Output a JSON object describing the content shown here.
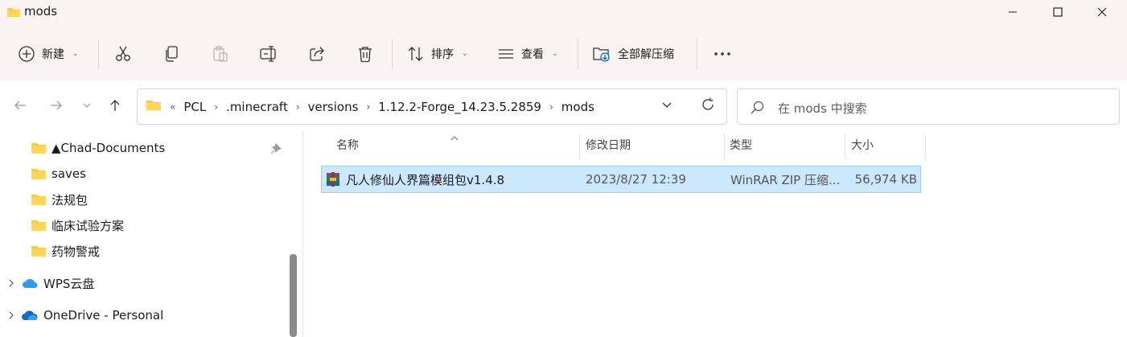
{
  "window": {
    "title": "mods",
    "buttons": [
      "minimize",
      "maximize",
      "close"
    ]
  },
  "toolbar": {
    "new_label": "新建",
    "sort_label": "排序",
    "view_label": "查看",
    "extract_label": "全部解压缩",
    "icons": [
      "plus-icon",
      "cut-icon",
      "copy-icon",
      "paste-icon",
      "rename-icon",
      "share-icon",
      "delete-icon",
      "sort-icon",
      "view-icon",
      "extract-icon",
      "more-icon"
    ]
  },
  "address": {
    "overflow": "«",
    "crumbs": [
      "PCL",
      ".minecraft",
      "versions",
      "1.12.2-Forge_14.23.5.2859",
      "mods"
    ]
  },
  "search": {
    "placeholder": "在 mods 中搜索"
  },
  "sidebar": {
    "items": [
      {
        "label": "▲Chad-Documents",
        "icon": "folder-icon",
        "pinned": true
      },
      {
        "label": "saves",
        "icon": "folder-icon"
      },
      {
        "label": "法规包",
        "icon": "folder-icon"
      },
      {
        "label": "临床试验方案",
        "icon": "folder-icon"
      },
      {
        "label": "药物警戒",
        "icon": "folder-icon"
      },
      {
        "label": "WPS云盘",
        "icon": "cloud-icon",
        "expandable": true
      },
      {
        "label": "OneDrive - Personal",
        "icon": "onedrive-icon",
        "expandable": true
      }
    ]
  },
  "columns": {
    "name": "名称",
    "modified": "修改日期",
    "type": "类型",
    "size": "大小"
  },
  "files": [
    {
      "name": "凡人修仙人界篇模组包v1.4.8",
      "modified": "2023/8/27 12:39",
      "type": "WinRAR ZIP 压缩...",
      "size": "56,974 KB",
      "icon": "winrar-archive-icon",
      "selected": true
    }
  ],
  "colors": {
    "selection_bg": "#cce8ff",
    "selection_border": "#99d1ff",
    "folder": "#ffc83d",
    "accent": "#0067c0"
  }
}
